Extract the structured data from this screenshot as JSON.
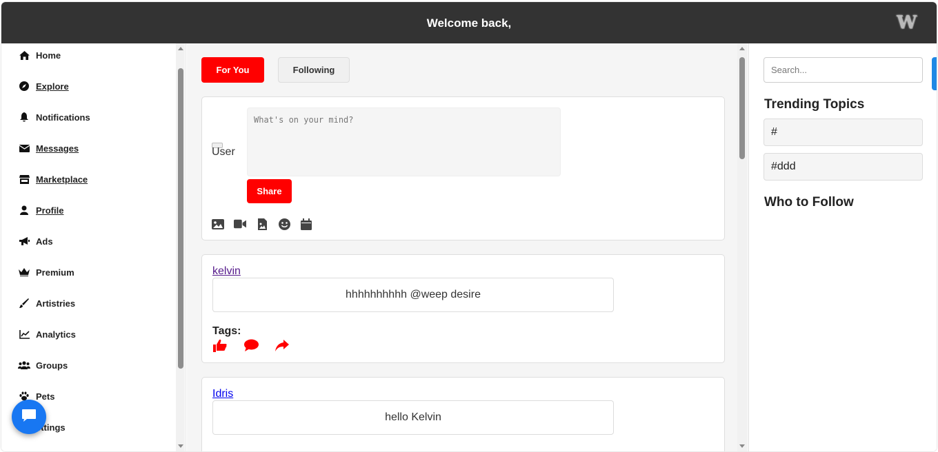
{
  "header": {
    "title": "Welcome back,",
    "logo": "W"
  },
  "sidebar": {
    "items": [
      {
        "label": "Home",
        "icon": "home-icon",
        "underline": false
      },
      {
        "label": "Explore",
        "icon": "compass-icon",
        "underline": true
      },
      {
        "label": "Notifications",
        "icon": "bell-icon",
        "underline": false
      },
      {
        "label": "Messages",
        "icon": "envelope-icon",
        "underline": true
      },
      {
        "label": "Marketplace",
        "icon": "store-icon",
        "underline": true
      },
      {
        "label": "Profile",
        "icon": "user-icon",
        "underline": true
      },
      {
        "label": "Ads",
        "icon": "megaphone-icon",
        "underline": false
      },
      {
        "label": "Premium",
        "icon": "crown-icon",
        "underline": false
      },
      {
        "label": "Artistries",
        "icon": "brush-icon",
        "underline": false
      },
      {
        "label": "Analytics",
        "icon": "chart-line-icon",
        "underline": false
      },
      {
        "label": "Groups",
        "icon": "users-icon",
        "underline": false
      },
      {
        "label": "Pets",
        "icon": "paw-icon",
        "underline": false
      },
      {
        "label": "ettings",
        "icon": "gear-icon",
        "underline": false
      }
    ]
  },
  "main": {
    "tabs": [
      {
        "label": "For You",
        "active": true
      },
      {
        "label": "Following",
        "active": false
      }
    ],
    "composer": {
      "avatar_alt": "User",
      "placeholder": "What's on your mind?",
      "share_label": "Share",
      "media_icons": [
        "image-icon",
        "video-icon",
        "file-image-icon",
        "smile-icon",
        "calendar-icon"
      ]
    },
    "posts": [
      {
        "author": "kelvin",
        "content": "hhhhhhhhhh @weep desire",
        "tags_label": "Tags:",
        "actions": [
          "like-icon",
          "comment-icon",
          "share-icon"
        ]
      },
      {
        "author": "Idris",
        "content": "hello Kelvin"
      }
    ]
  },
  "rightbar": {
    "search_placeholder": "Search...",
    "trending_title": "Trending Topics",
    "topics": [
      "#",
      "#ddd"
    ],
    "who_to_follow_title": "Who to Follow"
  },
  "colors": {
    "accent": "#ff0000",
    "topbar": "#333333",
    "chat_button": "#1877f2"
  }
}
